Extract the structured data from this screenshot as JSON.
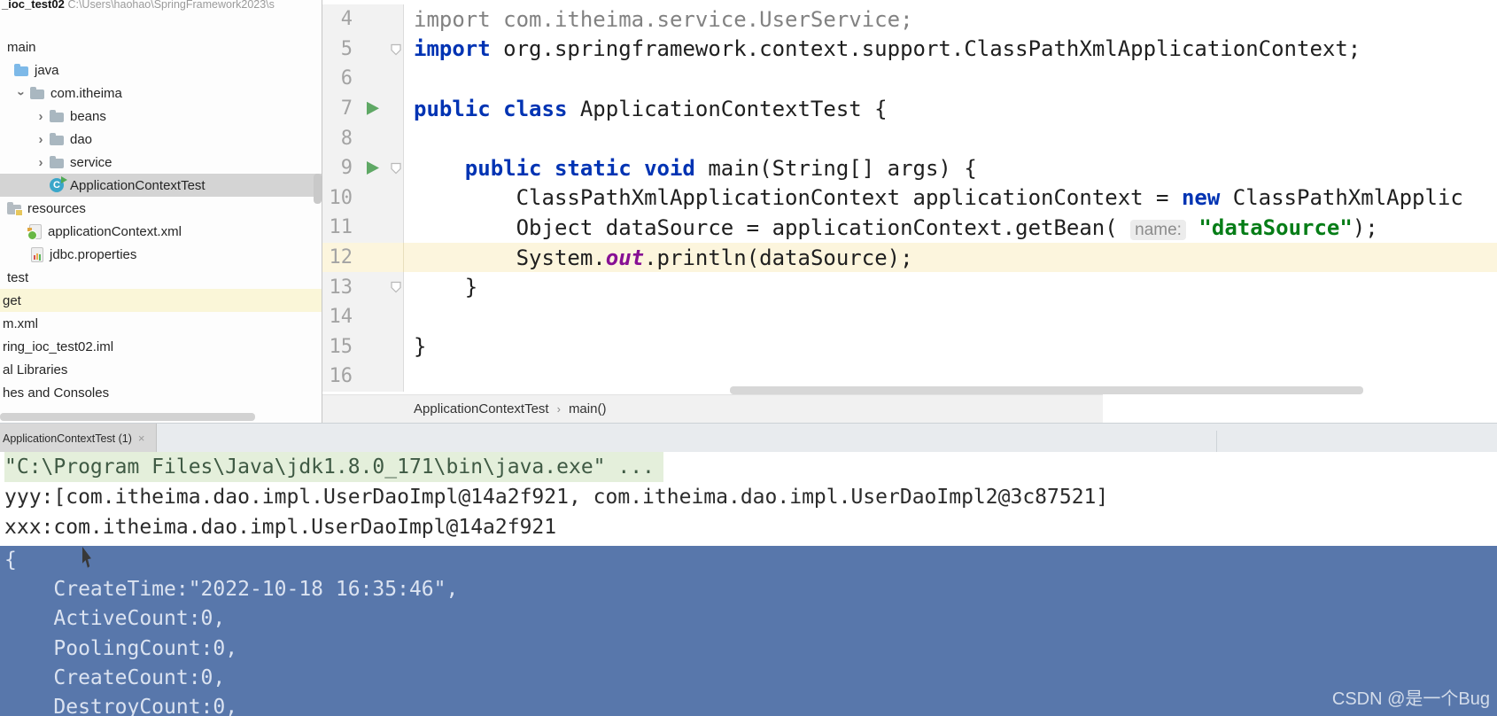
{
  "project_panel": {
    "header": {
      "name": "_ioc_test02",
      "path": "C:\\Users\\haohao\\SpringFramework2023\\s"
    },
    "items": [
      {
        "label": "main",
        "icon": "none",
        "chevron": "none",
        "pad": 8
      },
      {
        "label": "java",
        "icon": "folder-blue",
        "chevron": "none",
        "pad": 16
      },
      {
        "label": "com.itheima",
        "icon": "folder-pkg",
        "chevron": "down",
        "pad": 14
      },
      {
        "label": "beans",
        "icon": "folder-pkg",
        "chevron": "right",
        "pad": 36
      },
      {
        "label": "dao",
        "icon": "folder-pkg",
        "chevron": "right",
        "pad": 36
      },
      {
        "label": "service",
        "icon": "folder-pkg",
        "chevron": "right",
        "pad": 36
      },
      {
        "label": "ApplicationContextTest",
        "icon": "class-ic",
        "chevron": "none",
        "pad": 56,
        "selected": true
      },
      {
        "label": "resources",
        "icon": "folder-res",
        "chevron": "none",
        "pad": 8
      },
      {
        "label": "applicationContext.xml",
        "icon": "spring",
        "chevron": "none",
        "pad": 33
      },
      {
        "label": "jdbc.properties",
        "icon": "props",
        "chevron": "none",
        "pad": 35
      },
      {
        "label": "test",
        "icon": "none",
        "chevron": "none",
        "pad": 8
      },
      {
        "label": "get",
        "icon": "none",
        "chevron": "none",
        "pad": 3,
        "highlighted": true
      },
      {
        "label": "m.xml",
        "icon": "none",
        "chevron": "none",
        "pad": 3
      },
      {
        "label": "ring_ioc_test02.iml",
        "icon": "none",
        "chevron": "none",
        "pad": 3
      },
      {
        "label": "al Libraries",
        "icon": "none",
        "chevron": "none",
        "pad": 3
      },
      {
        "label": "hes and Consoles",
        "icon": "none",
        "chevron": "none",
        "pad": 3
      }
    ]
  },
  "editor": {
    "lines": [
      {
        "num": 4,
        "tokens": [
          [
            "gray",
            "import com.itheima.service.UserService;"
          ]
        ]
      },
      {
        "num": 5,
        "fold": true,
        "tokens": [
          [
            "kw",
            "import"
          ],
          [
            "txt",
            " org.springframework.context.support.ClassPathXmlApplicationContext;"
          ]
        ]
      },
      {
        "num": 6,
        "tokens": []
      },
      {
        "num": 7,
        "run": true,
        "tokens": [
          [
            "kw",
            "public class"
          ],
          [
            "txt",
            " ApplicationContextTest {"
          ]
        ]
      },
      {
        "num": 8,
        "tokens": []
      },
      {
        "num": 9,
        "run": true,
        "fold": true,
        "tokens": [
          [
            "txt",
            "    "
          ],
          [
            "kw",
            "public static void"
          ],
          [
            "txt",
            " main(String[] args) {"
          ]
        ]
      },
      {
        "num": 10,
        "tokens": [
          [
            "txt",
            "        ClassPathXmlApplicationContext applicationContext = "
          ],
          [
            "kw",
            "new"
          ],
          [
            "txt",
            " ClassPathXmlApplic"
          ]
        ]
      },
      {
        "num": 11,
        "tokens": [
          [
            "txt",
            "        Object dataSource = applicationContext.getBean( "
          ],
          [
            "hint",
            "name:"
          ],
          [
            "txt",
            " "
          ],
          [
            "str",
            "\"dataSource\""
          ],
          [
            "txt",
            ");"
          ]
        ]
      },
      {
        "num": 12,
        "hl": true,
        "tokens": [
          [
            "txt",
            "        System."
          ],
          [
            "out",
            "out"
          ],
          [
            "txt",
            ".println(dataSource);"
          ]
        ]
      },
      {
        "num": 13,
        "fold": true,
        "tokens": [
          [
            "txt",
            "    }"
          ]
        ]
      },
      {
        "num": 14,
        "tokens": []
      },
      {
        "num": 15,
        "tokens": [
          [
            "txt",
            "}"
          ]
        ]
      },
      {
        "num": 16,
        "tokens": []
      }
    ],
    "breadcrumb": [
      "ApplicationContextTest",
      "main()"
    ],
    "breadcrumb_separator": "›"
  },
  "console": {
    "tab": {
      "label": "ApplicationContextTest (1)",
      "close": "×"
    },
    "lines": [
      {
        "text": "\"C:\\Program Files\\Java\\jdk1.8.0_171\\bin\\java.exe\" ...",
        "cmd": true
      },
      {
        "text": "yyy:[com.itheima.dao.impl.UserDaoImpl@14a2f921, com.itheima.dao.impl.UserDaoImpl2@3c87521]"
      },
      {
        "text": "xxx:com.itheima.dao.impl.UserDaoImpl@14a2f921"
      }
    ],
    "selection_lines": [
      "{",
      "    CreateTime:\"2022-10-18 16:35:46\",",
      "    ActiveCount:0,",
      "    PoolingCount:0,",
      "    CreateCount:0,",
      "    DestroyCount:0,"
    ]
  },
  "watermark": "CSDN @是一个Bug",
  "colors": {
    "selection_blue": "#5877ab",
    "current_line": "#fcf5dd",
    "keyword": "#0033b3",
    "string_green": "#067d17",
    "run_green": "#5fa865",
    "tree_selected": "#d4d4d4",
    "tree_highlight": "#faf6d8"
  }
}
